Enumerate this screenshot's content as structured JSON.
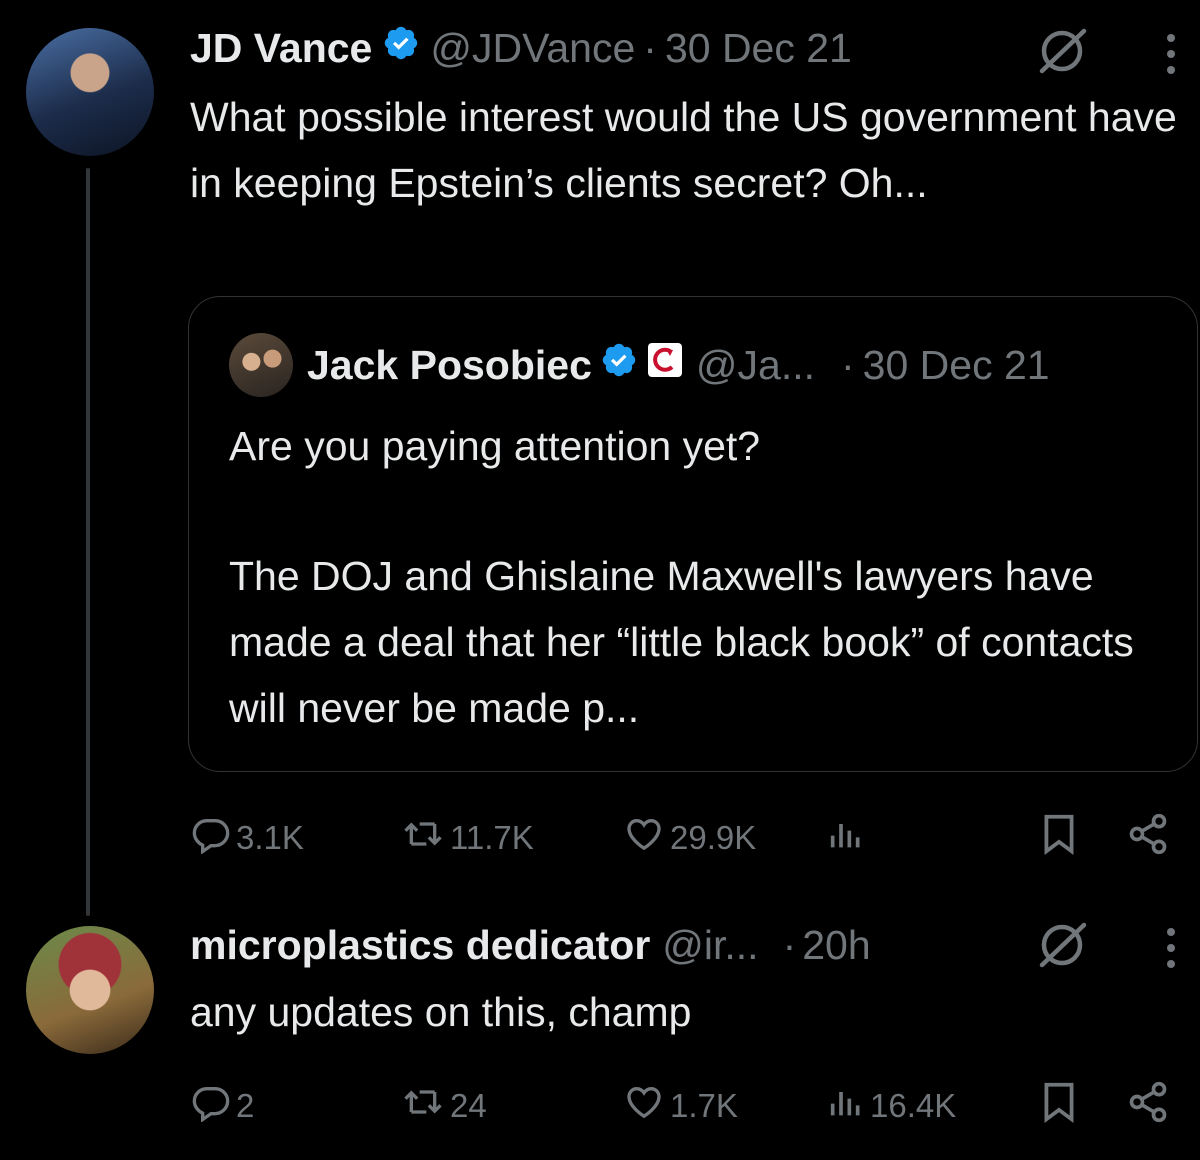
{
  "tweet1": {
    "display_name": "JD Vance",
    "handle": "@JDVance",
    "sep": "·",
    "date": "30 Dec 21",
    "text": "What possible interest would the US government have in keeping Epstein’s clients secret? Oh...",
    "quote": {
      "display_name": "Jack Posobiec",
      "handle": "@Ja...",
      "sep": "·",
      "date": "30 Dec 21",
      "text_p1": "Are you paying attention yet?",
      "text_p2": "The DOJ and Ghislaine Maxwell's lawyers have made a deal that her “little black book” of contacts will never be made p..."
    },
    "actions": {
      "replies": "3.1K",
      "reposts": "11.7K",
      "likes": "29.9K",
      "views": ""
    }
  },
  "tweet2": {
    "display_name": "microplastics dedicator",
    "handle": "@ir...",
    "sep": "·",
    "date": "20h",
    "text": "any updates on this, champ",
    "actions": {
      "replies": "2",
      "reposts": "24",
      "likes": "1.7K",
      "views": "16.4K"
    }
  },
  "icons": {
    "verified": "verified-badge-icon",
    "grok": "grok-icon",
    "menu": "more-vertical-icon",
    "reply": "reply-icon",
    "repost": "repost-icon",
    "like": "heart-icon",
    "views": "views-icon",
    "bookmark": "bookmark-icon",
    "share": "share-icon"
  },
  "colors": {
    "background": "#000000",
    "text": "#e7e9ea",
    "muted": "#71767b",
    "verified": "#1d9bf0",
    "border": "#2f3336"
  }
}
